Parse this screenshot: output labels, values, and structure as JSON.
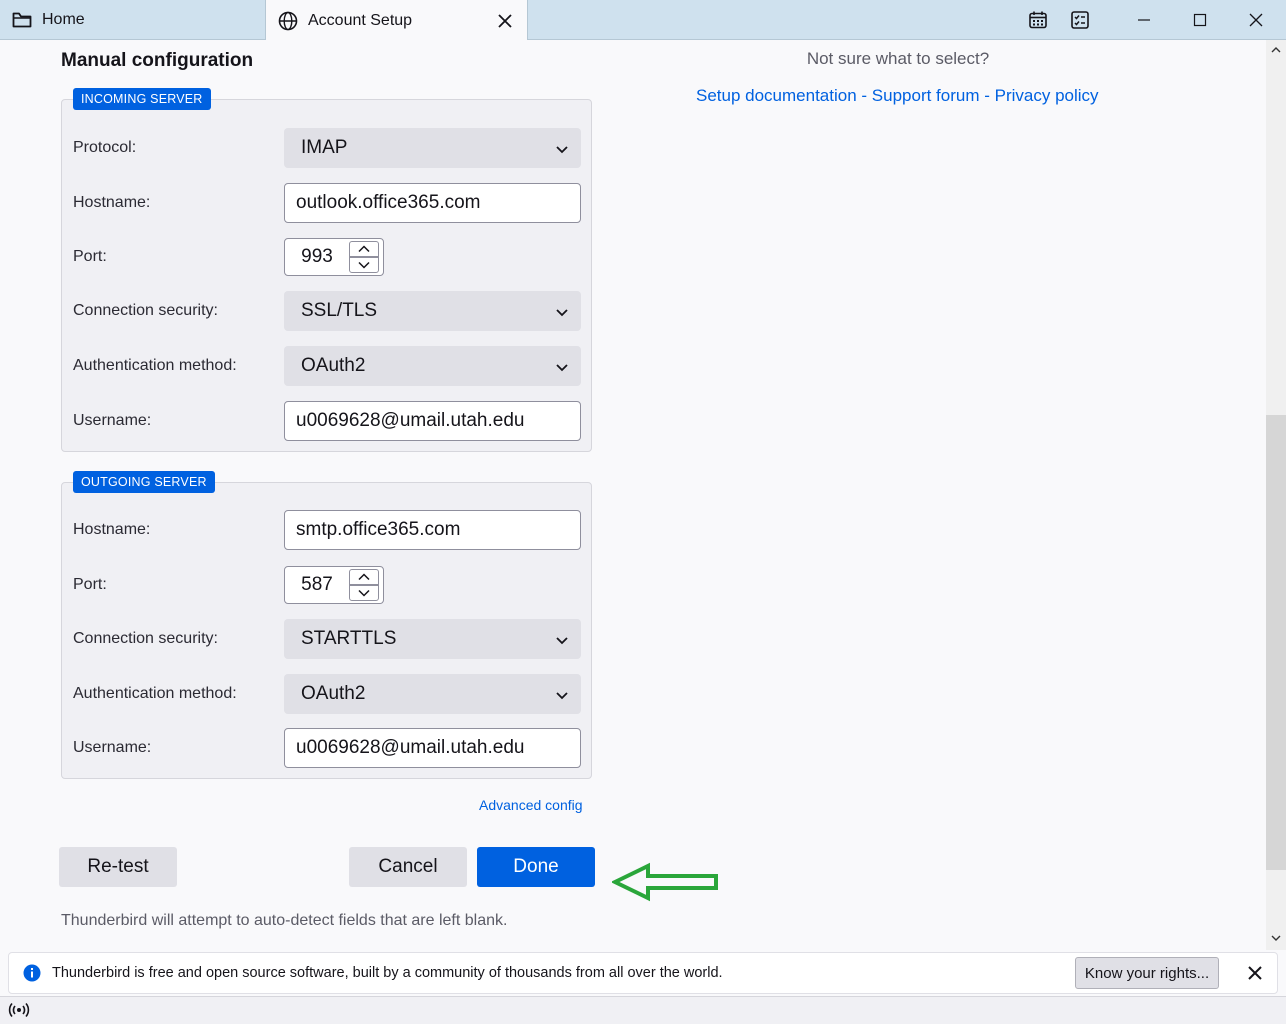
{
  "tabs": [
    {
      "label": "Home",
      "icon": "folder-icon"
    },
    {
      "label": "Account Setup",
      "icon": "globe-icon"
    }
  ],
  "window_controls": [
    "calendar-icon",
    "tasks-icon",
    "minimize-icon",
    "maximize-icon",
    "close-icon"
  ],
  "main": {
    "section_title": "Manual configuration",
    "incoming": {
      "legend": "INCOMING SERVER",
      "protocol_label": "Protocol:",
      "protocol_value": "IMAP",
      "hostname_label": "Hostname:",
      "hostname_value": "outlook.office365.com",
      "port_label": "Port:",
      "port_value": "993",
      "security_label": "Connection security:",
      "security_value": "SSL/TLS",
      "auth_label": "Authentication method:",
      "auth_value": "OAuth2",
      "username_label": "Username:",
      "username_value": "u0069628@umail.utah.edu"
    },
    "outgoing": {
      "legend": "OUTGOING SERVER",
      "hostname_label": "Hostname:",
      "hostname_value": "smtp.office365.com",
      "port_label": "Port:",
      "port_value": "587",
      "security_label": "Connection security:",
      "security_value": "STARTTLS",
      "auth_label": "Authentication method:",
      "auth_value": "OAuth2",
      "username_label": "Username:",
      "username_value": "u0069628@umail.utah.edu"
    },
    "advanced_config": "Advanced config",
    "retest_label": "Re-test",
    "cancel_label": "Cancel",
    "done_label": "Done",
    "hint": "Thunderbird will attempt to auto-detect fields that are left blank."
  },
  "help": {
    "question": "Not sure what to select?",
    "setup_docs": "Setup documentation",
    "separator": " - ",
    "support_forum": "Support forum",
    "privacy_policy": "Privacy policy"
  },
  "notification": {
    "message": "Thunderbird is free and open source software, built by a community of thousands from all over the world.",
    "rights_button": "Know your rights..."
  },
  "colors": {
    "accent": "#0061e0",
    "annotation_arrow": "#2aa63a",
    "titlebar": "#cfe1ee"
  }
}
